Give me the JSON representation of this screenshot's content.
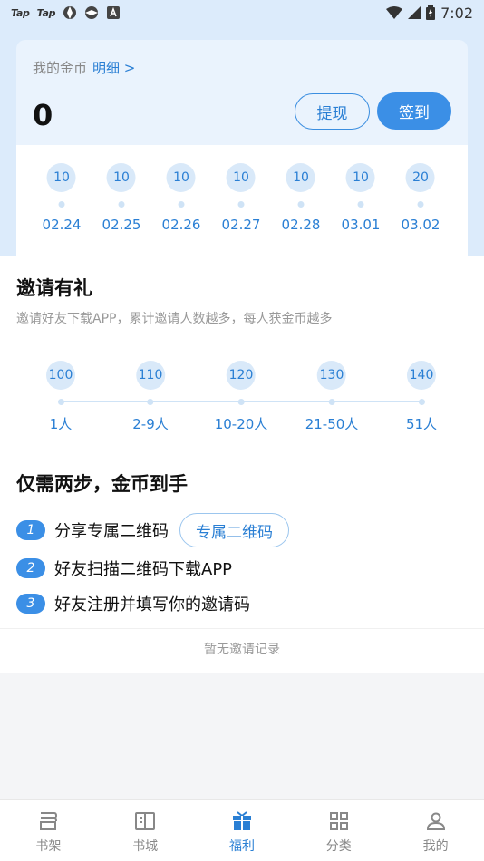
{
  "status_bar": {
    "left_apps": [
      "Tap",
      "Tap"
    ],
    "time": "7:02"
  },
  "coins": {
    "label": "我的金币",
    "detail_link": "明细 >",
    "value": "0",
    "withdraw_label": "提现",
    "signin_label": "签到",
    "daily": [
      {
        "amount": "10",
        "date": "02.24"
      },
      {
        "amount": "10",
        "date": "02.25"
      },
      {
        "amount": "10",
        "date": "02.26"
      },
      {
        "amount": "10",
        "date": "02.27"
      },
      {
        "amount": "10",
        "date": "02.28"
      },
      {
        "amount": "10",
        "date": "03.01"
      },
      {
        "amount": "20",
        "date": "03.02"
      }
    ]
  },
  "invite": {
    "title": "邀请有礼",
    "subtitle": "邀请好友下载APP，累计邀请人数越多，每人获金币越多",
    "tiers": [
      {
        "amount": "100",
        "people": "1人"
      },
      {
        "amount": "110",
        "people": "2-9人"
      },
      {
        "amount": "120",
        "people": "10-20人"
      },
      {
        "amount": "130",
        "people": "21-50人"
      },
      {
        "amount": "140",
        "people": "51人"
      }
    ]
  },
  "steps": {
    "title": "仅需两步，金币到手",
    "items": [
      {
        "num": "1",
        "text": "分享专属二维码"
      },
      {
        "num": "2",
        "text": "好友扫描二维码下载APP"
      },
      {
        "num": "3",
        "text": "好友注册并填写你的邀请码"
      }
    ],
    "qr_button": "专属二维码"
  },
  "records": {
    "empty_text": "暂无邀请记录"
  },
  "nav": {
    "items": [
      {
        "label": "书架",
        "icon": "bookshelf-icon"
      },
      {
        "label": "书城",
        "icon": "book-open-icon"
      },
      {
        "label": "福利",
        "icon": "gift-icon"
      },
      {
        "label": "分类",
        "icon": "grid-icon"
      },
      {
        "label": "我的",
        "icon": "user-icon"
      }
    ],
    "active_index": 2
  },
  "colors": {
    "accent": "#3b8fe6",
    "top_background": "#dcebfb"
  }
}
